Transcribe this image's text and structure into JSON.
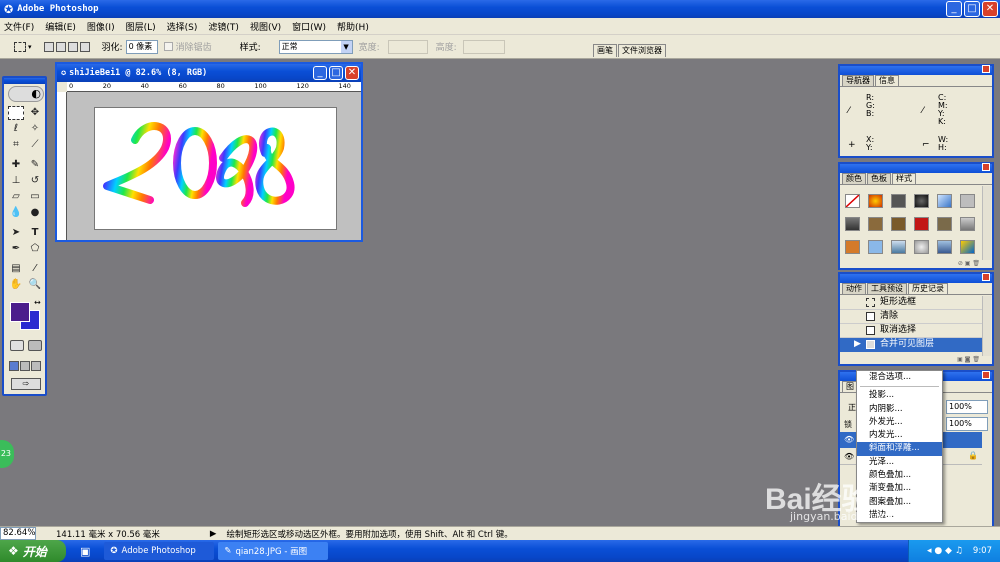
{
  "app": {
    "title": "Adobe Photoshop"
  },
  "menu": [
    "文件(F)",
    "编辑(E)",
    "图像(I)",
    "图层(L)",
    "选择(S)",
    "滤镜(T)",
    "视图(V)",
    "窗口(W)",
    "帮助(H)"
  ],
  "options": {
    "feather_label": "羽化:",
    "feather_value": "0 像素",
    "antialias": "消除锯齿",
    "style_label": "样式:",
    "style_value": "正常",
    "width_label": "宽度:",
    "height_label": "高度:",
    "tab_brushes": "画笔",
    "tab_filebrowser": "文件浏览器"
  },
  "document": {
    "title": "shiJieBei1 @ 82.6% (8, RGB)",
    "ruler": [
      "0",
      "20",
      "40",
      "60",
      "80",
      "100",
      "120",
      "140"
    ],
    "artwork": "2008"
  },
  "navigator": {
    "tab1": "导航器",
    "tab2": "信息",
    "rgb": "R:\nG:\nB:",
    "cmyk": "C:\nM:\nY:\nK:",
    "xy": "X:\nY:",
    "wh": "W:\nH:"
  },
  "swatches": {
    "tab1": "颜色",
    "tab2": "色板",
    "tab3": "样式"
  },
  "history": {
    "tab1": "动作",
    "tab2": "工具预设",
    "tab3": "历史记录",
    "items": [
      "矩形选框",
      "清除",
      "取消选择",
      "合并可见图层"
    ]
  },
  "layers": {
    "opacity": "100%",
    "fill": "100%",
    "tab_partial": "图",
    "mode_partial": "正",
    "lock_partial": "锁"
  },
  "context_menu": {
    "items": [
      "混合选项...",
      "投影...",
      "内阴影...",
      "外发光...",
      "内发光...",
      "斜面和浮雕...",
      "光泽...",
      "颜色叠加...",
      "渐变叠加...",
      "图案叠加...",
      "描边..."
    ],
    "highlighted": "斜面和浮雕..."
  },
  "status": {
    "zoom": "82.64%",
    "size": "141.11 毫米 x 70.56 毫米",
    "hint": "绘制矩形选区或移动选区外框。要用附加选项，使用 Shift、Alt 和 Ctrl 键。"
  },
  "taskbar": {
    "start": "开始",
    "task1": "Adobe Photoshop",
    "task2": "qian28.JPG - 画图",
    "clock": "9:07",
    "badge": "23"
  },
  "watermark": {
    "text": "Bai经验",
    "url": "jingyan.baidu.com"
  },
  "colors": {
    "foreground": "#4b1d8c",
    "background": "#2a2ad0",
    "highlight": "#316ac5"
  }
}
